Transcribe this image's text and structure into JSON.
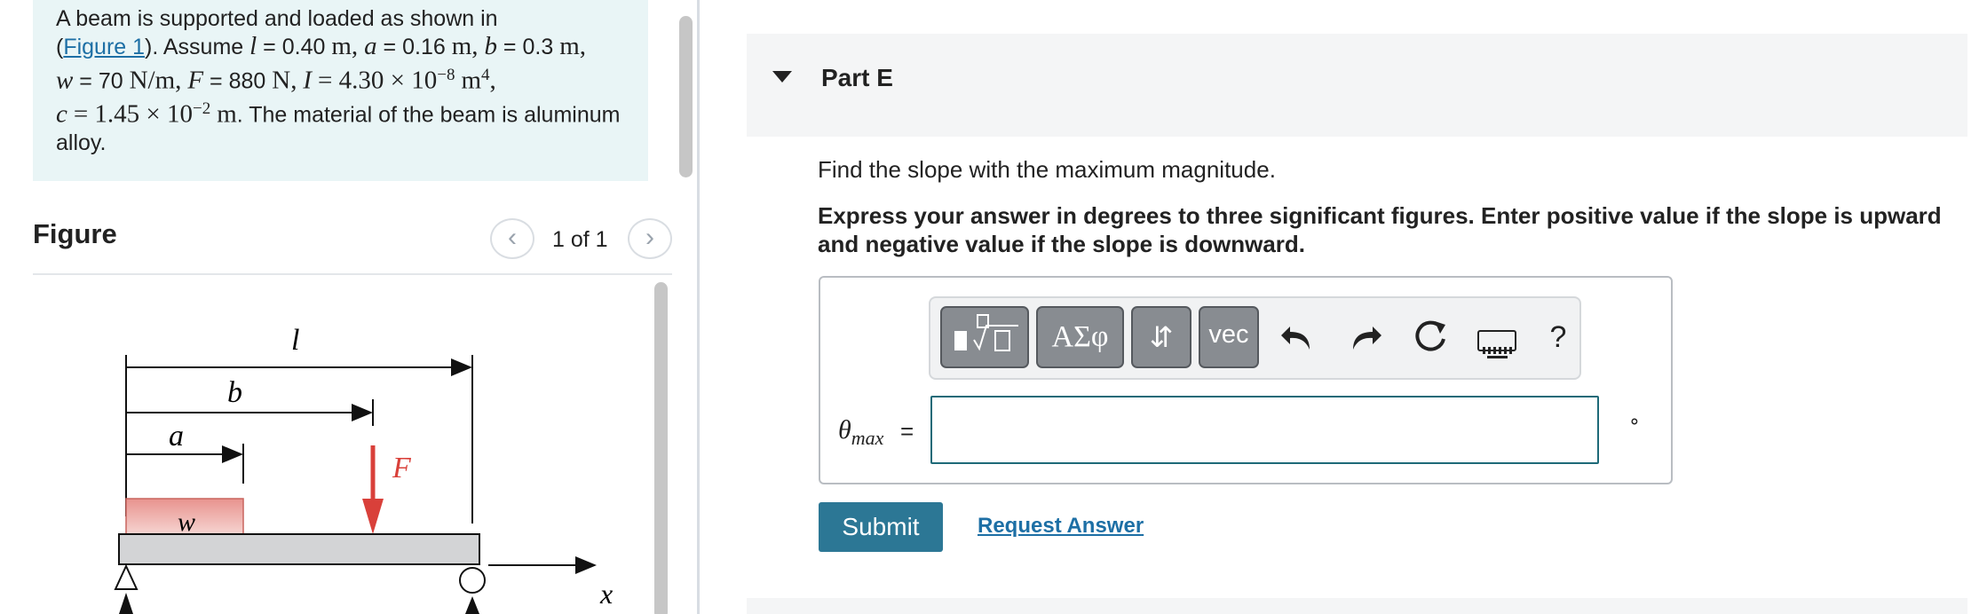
{
  "problem": {
    "intro": "A beam is supported and loaded as shown in",
    "link": "Figure 1",
    "assume": "). Assume",
    "l_sym": "l",
    "l_val": "= 0.40",
    "a_sym": "a",
    "a_val": "= 0.16",
    "b_sym": "b",
    "b_val": "= 0.3",
    "w_sym": "w",
    "w_val": "= 70",
    "F_sym": "F",
    "F_val": "= 880",
    "I_sym": "I",
    "I_val": "= 4.30 × 10",
    "I_exp": "−8",
    "c_sym": "c",
    "c_val": "= 1.45 × 10",
    "c_exp": "−2",
    "material": ". The material of the beam is aluminum alloy.",
    "unit_m": "m",
    "unit_Nm": "N/m",
    "unit_N": "N",
    "unit_m4": "m",
    "exp4": "4",
    "comma": ","
  },
  "figure": {
    "title": "Figure",
    "counter": "1 of 1",
    "prev": "‹",
    "next": "›",
    "labels": {
      "l": "l",
      "b": "b",
      "a": "a",
      "F": "F",
      "w": "w",
      "x": "x"
    }
  },
  "part": {
    "title": "Part E",
    "question": "Find the slope with the maximum magnitude.",
    "instructions": "Express your answer in degrees to three significant figures. Enter positive value if the slope is upward and negative value if the slope is downward."
  },
  "toolbar": {
    "greek": "ΑΣφ",
    "arrows": "⇵",
    "vec": "vec",
    "undo_icon": "undo-icon",
    "redo_icon": "redo-icon",
    "reset_icon": "reset-icon",
    "keyboard_icon": "keyboard-icon",
    "help": "?"
  },
  "answer": {
    "label": "θ",
    "label_sub": "max",
    "equals": "=",
    "value": "",
    "unit": "∘"
  },
  "actions": {
    "submit": "Submit",
    "request_answer": "Request Answer"
  },
  "colors": {
    "accent": "#2c7795",
    "link": "#1d6fa5",
    "problem_bg": "#e9f5f6",
    "load_red": "#d9403a"
  }
}
